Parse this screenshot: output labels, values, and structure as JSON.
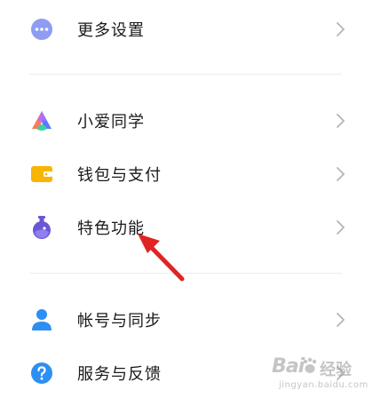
{
  "settings": {
    "items": [
      {
        "label": "更多设置",
        "icon": "more-dots-icon"
      },
      {
        "label": "小爱同学",
        "icon": "xiaoai-assistant-icon"
      },
      {
        "label": "钱包与支付",
        "icon": "wallet-icon"
      },
      {
        "label": "特色功能",
        "icon": "flask-icon"
      },
      {
        "label": "帐号与同步",
        "icon": "person-icon"
      },
      {
        "label": "服务与反馈",
        "icon": "help-question-icon"
      }
    ]
  },
  "annotation": {
    "arrow_color": "#e02424"
  },
  "watermark": {
    "main": "Bai",
    "jingyan": "经验",
    "url": "jingyan.baidu.com"
  },
  "colors": {
    "more_settings_icon": "#8e9cf2",
    "wallet_icon": "#f7b500",
    "flask_icon": "#6a57d8",
    "person_icon": "#2e8ff3",
    "help_icon": "#2e8ff3"
  }
}
